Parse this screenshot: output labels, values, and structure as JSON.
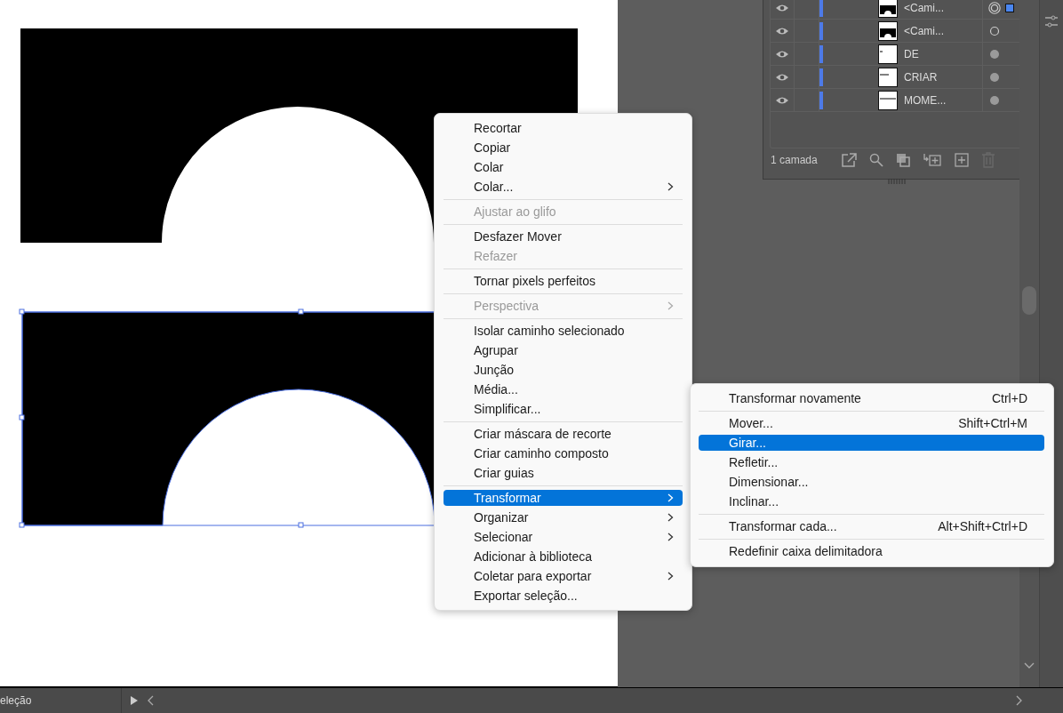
{
  "layers": [
    {
      "name": "<Cami...",
      "kind": "arch",
      "visible": true,
      "targeted": true,
      "selected_art": true
    },
    {
      "name": "<Cami...",
      "kind": "arch",
      "visible": true,
      "targeted": false,
      "filled": false,
      "selected_art": false
    },
    {
      "name": "DE",
      "kind": "short",
      "visible": true,
      "targeted": false,
      "filled": true,
      "selected_art": false
    },
    {
      "name": "CRIAR",
      "kind": "mid",
      "visible": true,
      "targeted": false,
      "filled": true,
      "selected_art": false
    },
    {
      "name": "MOME...",
      "kind": "long",
      "visible": true,
      "targeted": false,
      "filled": true,
      "selected_art": false
    }
  ],
  "layers_footer": {
    "count": "1 camada"
  },
  "status_bar": {
    "tool": "eleção"
  },
  "context_menu": [
    {
      "kind": "item",
      "label": "Recortar",
      "disabled": false,
      "submenu": false,
      "selected": false
    },
    {
      "kind": "item",
      "label": "Copiar",
      "disabled": false,
      "submenu": false,
      "selected": false
    },
    {
      "kind": "item",
      "label": "Colar",
      "disabled": false,
      "submenu": false,
      "selected": false
    },
    {
      "kind": "item",
      "label": "Colar...",
      "disabled": false,
      "submenu": true,
      "selected": false
    },
    {
      "kind": "separator"
    },
    {
      "kind": "item",
      "label": "Ajustar ao glifo",
      "disabled": true,
      "submenu": false,
      "selected": false
    },
    {
      "kind": "separator"
    },
    {
      "kind": "item",
      "label": "Desfazer Mover",
      "disabled": false,
      "submenu": false,
      "selected": false
    },
    {
      "kind": "item",
      "label": "Refazer",
      "disabled": true,
      "submenu": false,
      "selected": false
    },
    {
      "kind": "separator"
    },
    {
      "kind": "item",
      "label": "Tornar pixels perfeitos",
      "disabled": false,
      "submenu": false,
      "selected": false
    },
    {
      "kind": "separator"
    },
    {
      "kind": "item",
      "label": "Perspectiva",
      "disabled": true,
      "submenu": true,
      "selected": false
    },
    {
      "kind": "separator"
    },
    {
      "kind": "item",
      "label": "Isolar caminho selecionado",
      "disabled": false,
      "submenu": false,
      "selected": false
    },
    {
      "kind": "item",
      "label": "Agrupar",
      "disabled": false,
      "submenu": false,
      "selected": false
    },
    {
      "kind": "item",
      "label": "Junção",
      "disabled": false,
      "submenu": false,
      "selected": false
    },
    {
      "kind": "item",
      "label": "Média...",
      "disabled": false,
      "submenu": false,
      "selected": false
    },
    {
      "kind": "item",
      "label": "Simplificar...",
      "disabled": false,
      "submenu": false,
      "selected": false
    },
    {
      "kind": "separator"
    },
    {
      "kind": "item",
      "label": "Criar máscara de recorte",
      "disabled": false,
      "submenu": false,
      "selected": false
    },
    {
      "kind": "item",
      "label": "Criar caminho composto",
      "disabled": false,
      "submenu": false,
      "selected": false
    },
    {
      "kind": "item",
      "label": "Criar guias",
      "disabled": false,
      "submenu": false,
      "selected": false
    },
    {
      "kind": "separator"
    },
    {
      "kind": "item",
      "label": "Transformar",
      "disabled": false,
      "submenu": true,
      "selected": true
    },
    {
      "kind": "item",
      "label": "Organizar",
      "disabled": false,
      "submenu": true,
      "selected": false
    },
    {
      "kind": "item",
      "label": "Selecionar",
      "disabled": false,
      "submenu": true,
      "selected": false
    },
    {
      "kind": "item",
      "label": "Adicionar à biblioteca",
      "disabled": false,
      "submenu": false,
      "selected": false
    },
    {
      "kind": "item",
      "label": "Coletar para exportar",
      "disabled": false,
      "submenu": true,
      "selected": false
    },
    {
      "kind": "item",
      "label": "Exportar seleção...",
      "disabled": false,
      "submenu": false,
      "selected": false
    }
  ],
  "submenu": [
    {
      "kind": "item",
      "label": "Transformar novamente",
      "shortcut": "Ctrl+D",
      "selected": false
    },
    {
      "kind": "separator"
    },
    {
      "kind": "item",
      "label": "Mover...",
      "shortcut": "Shift+Ctrl+M",
      "selected": false
    },
    {
      "kind": "item",
      "label": "Girar...",
      "selected": true
    },
    {
      "kind": "item",
      "label": "Refletir...",
      "selected": false
    },
    {
      "kind": "item",
      "label": "Dimensionar...",
      "selected": false
    },
    {
      "kind": "item",
      "label": "Inclinar...",
      "selected": false
    },
    {
      "kind": "separator"
    },
    {
      "kind": "item",
      "label": "Transformar cada...",
      "shortcut": "Alt+Shift+Ctrl+D",
      "selected": false
    },
    {
      "kind": "separator"
    },
    {
      "kind": "item",
      "label": "Redefinir caixa delimitadora",
      "selected": false
    }
  ]
}
